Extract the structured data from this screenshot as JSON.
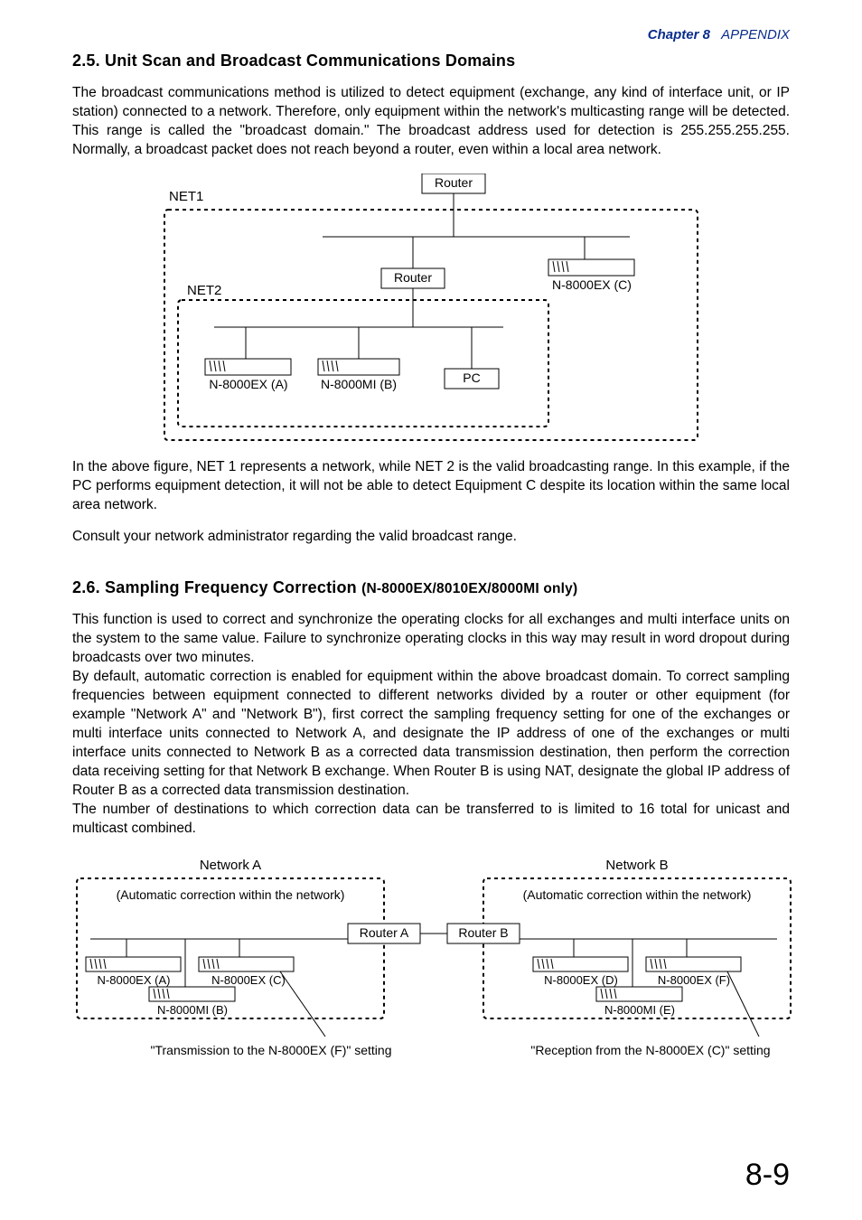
{
  "header": {
    "chapter_label": "Chapter 8",
    "chapter_title": "APPENDIX"
  },
  "page_number": "8-9",
  "sections": {
    "s25": {
      "title": "2.5. Unit Scan and Broadcast Communications Domains",
      "body1": "The broadcast communications method is utilized to detect equipment (exchange, any kind of interface unit, or IP station) connected to a network. Therefore, only equipment within the network's multicasting range will be detected. This range is called the \"broadcast domain.\" The broadcast address used for detection is 255.255.255.255. Normally, a broadcast packet does not reach beyond a router, even within a local area network.",
      "body2": "In the above figure, NET 1 represents a network, while NET 2 is the valid broadcasting range. In this example, if the PC performs equipment detection, it will not be able to detect Equipment C despite its location within the same local area network.",
      "body3": "Consult your network administrator regarding the valid broadcast range."
    },
    "s26": {
      "title_main": "2.6. Sampling Frequency Correction",
      "title_sub": "(N-8000EX/8010EX/8000MI only)",
      "body1": "This function is used to correct and synchronize the operating clocks for all exchanges and multi interface units on the system to the same value. Failure to synchronize operating clocks in this way may result in word dropout during broadcasts over two minutes.",
      "body2": "By default, automatic correction is enabled for equipment within the above broadcast domain. To correct sampling frequencies between equipment connected to different networks divided by a router or other equipment (for example \"Network A\" and \"Network B\"), first correct the sampling frequency setting for one of the exchanges or multi interface units connected to Network A, and designate the IP address of one of the exchanges or multi interface units connected to Network B as a corrected data transmission destination, then perform the correction data receiving setting for that Network B exchange. When Router B is using NAT, designate the global IP address of Router B as a corrected data transmission destination.",
      "body3": "The number of destinations to which correction data can be transferred to is limited to 16 total for unicast and multicast combined."
    }
  },
  "diagram1": {
    "net1_label": "NET1",
    "net2_label": "NET2",
    "router_top": "Router",
    "router_mid": "Router",
    "device_a": "N-8000EX (A)",
    "device_b": "N-8000MI (B)",
    "device_pc": "PC",
    "device_c": "N-8000EX (C)"
  },
  "diagram2": {
    "networkA": "Network A",
    "networkB": "Network B",
    "autoA": "(Automatic correction within the network)",
    "autoB": "(Automatic correction within the network)",
    "routerA": "Router A",
    "routerB": "Router B",
    "dev_a": "N-8000EX (A)",
    "dev_b": "N-8000MI (B)",
    "dev_c": "N-8000EX (C)",
    "dev_d": "N-8000EX (D)",
    "dev_e": "N-8000MI (E)",
    "dev_f": "N-8000EX (F)",
    "captionA": "\"Transmission to the N-8000EX (F)\" setting",
    "captionB": "\"Reception from the N-8000EX (C)\" setting"
  }
}
